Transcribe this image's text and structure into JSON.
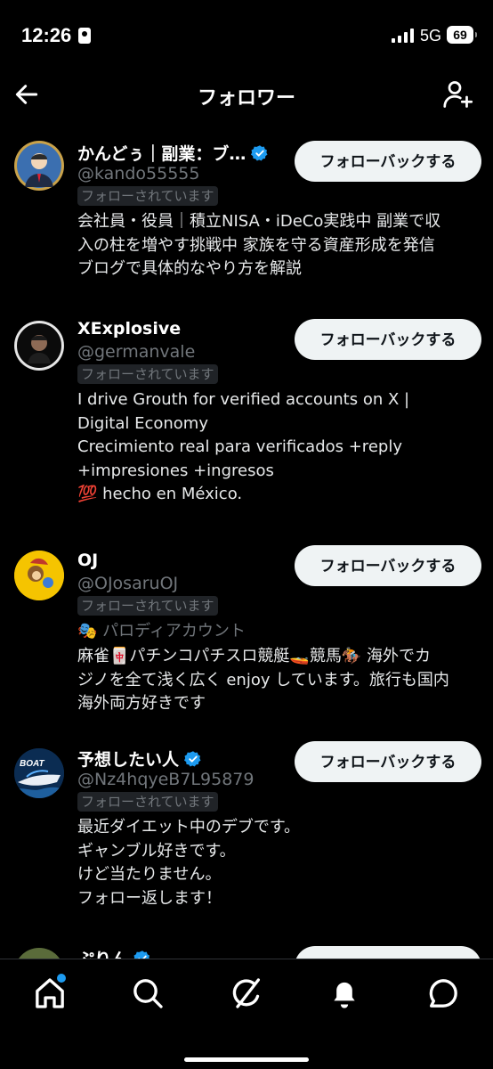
{
  "status_bar": {
    "time": "12:26",
    "network": "5G",
    "battery": "69"
  },
  "header": {
    "title": "フォロワー"
  },
  "users": [
    {
      "name": "かんどぅ｜副業：ブ…",
      "verified": true,
      "handle": "@kando55555",
      "follows_you": "フォローされています",
      "button": "フォローバックする",
      "bio": "会社員・役員｜積立NISA・iDeCo実践中 副業で収\n入の柱を増やす挑戦中 家族を守る資産形成を発信\nブログで具体的なやり方を解説"
    },
    {
      "name": "XExplosive",
      "verified": false,
      "handle": "@germanvale",
      "follows_you": "フォローされています",
      "button": "フォローバックする",
      "bio": "I drive Grouth for verified accounts on X |\nDigital Economy\nCrecimiento real para verificados +reply\n+impresiones +ingresos\n💯 hecho en México."
    },
    {
      "name": "OJ",
      "verified": false,
      "handle": "@OJosaruOJ",
      "follows_you": "フォローされています",
      "parody_label": "🎭 パロディアカウント",
      "button": "フォローバックする",
      "bio": "麻雀🀄パチンコパチスロ競艇🚤競馬🏇 海外でカ\nジノを全て浅く広く enjoy しています。旅行も国内\n海外両方好きです"
    },
    {
      "name": "予想したい人",
      "verified": true,
      "handle": "@Nz4hqyeB7L95879",
      "follows_you": "フォローされています",
      "button": "フォローバックする",
      "bio": "最近ダイエット中のデブです。\nギャンブル好きです。\nけど当たりません。\nフォロー返します！",
      "avatar_text": "BOAT"
    },
    {
      "name": "ぷりん",
      "verified": true
    }
  ],
  "colors": {
    "accent": "#1d9bf0",
    "muted": "#71767b",
    "button_bg": "#eff3f4"
  },
  "nav": {
    "items": [
      "home-icon",
      "search-icon",
      "grok-icon",
      "notifications-icon",
      "messages-icon"
    ]
  }
}
